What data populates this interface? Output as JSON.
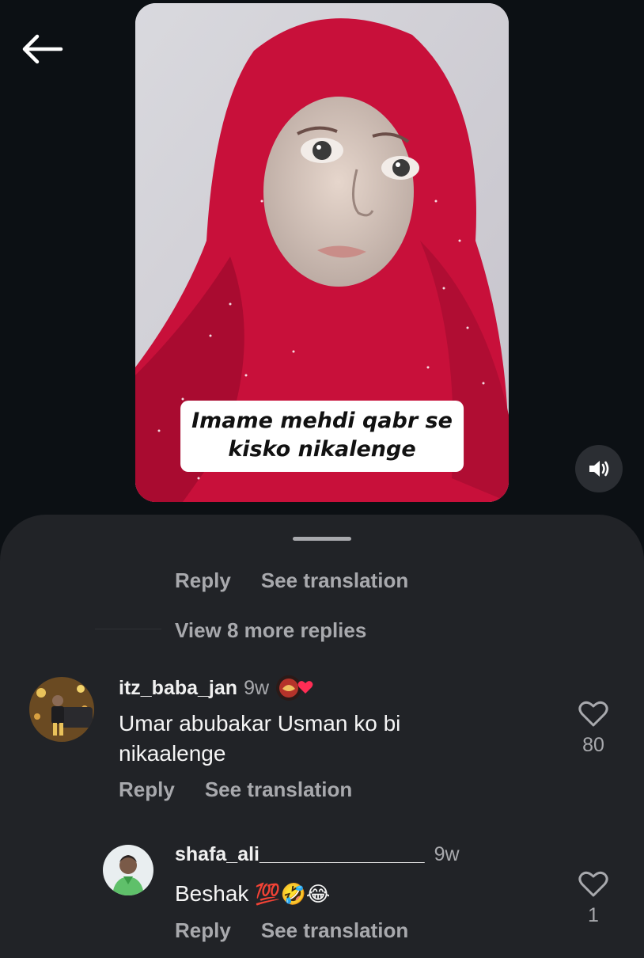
{
  "video": {
    "caption_line1": "Imame mehdi qabr se",
    "caption_line2": "kisko nikalenge"
  },
  "thread": {
    "reply_label": "Reply",
    "see_translation_label": "See translation",
    "view_more_label": "View 8 more replies"
  },
  "comments": [
    {
      "username": "itz_baba_jan",
      "time": "9w",
      "text_line1": "Umar abubakar Usman ko bi",
      "text_line2": "nikaalenge",
      "likes": "80",
      "reply_label": "Reply",
      "see_translation_label": "See translation"
    },
    {
      "username": "shafa_ali_______________",
      "time": "9w",
      "text": "Beshak",
      "emojis": "💯🤣😂",
      "likes": "1",
      "reply_label": "Reply",
      "see_translation_label": "See translation"
    }
  ],
  "colors": {
    "background": "#0c1014",
    "sheet": "#212327",
    "muted_text": "#a8a9ad",
    "hijab": "#c8103a",
    "heart_badge": "#ff2d55"
  },
  "icons": [
    "back-arrow-icon",
    "sound-on-icon",
    "heart-outline-icon",
    "drag-handle"
  ]
}
